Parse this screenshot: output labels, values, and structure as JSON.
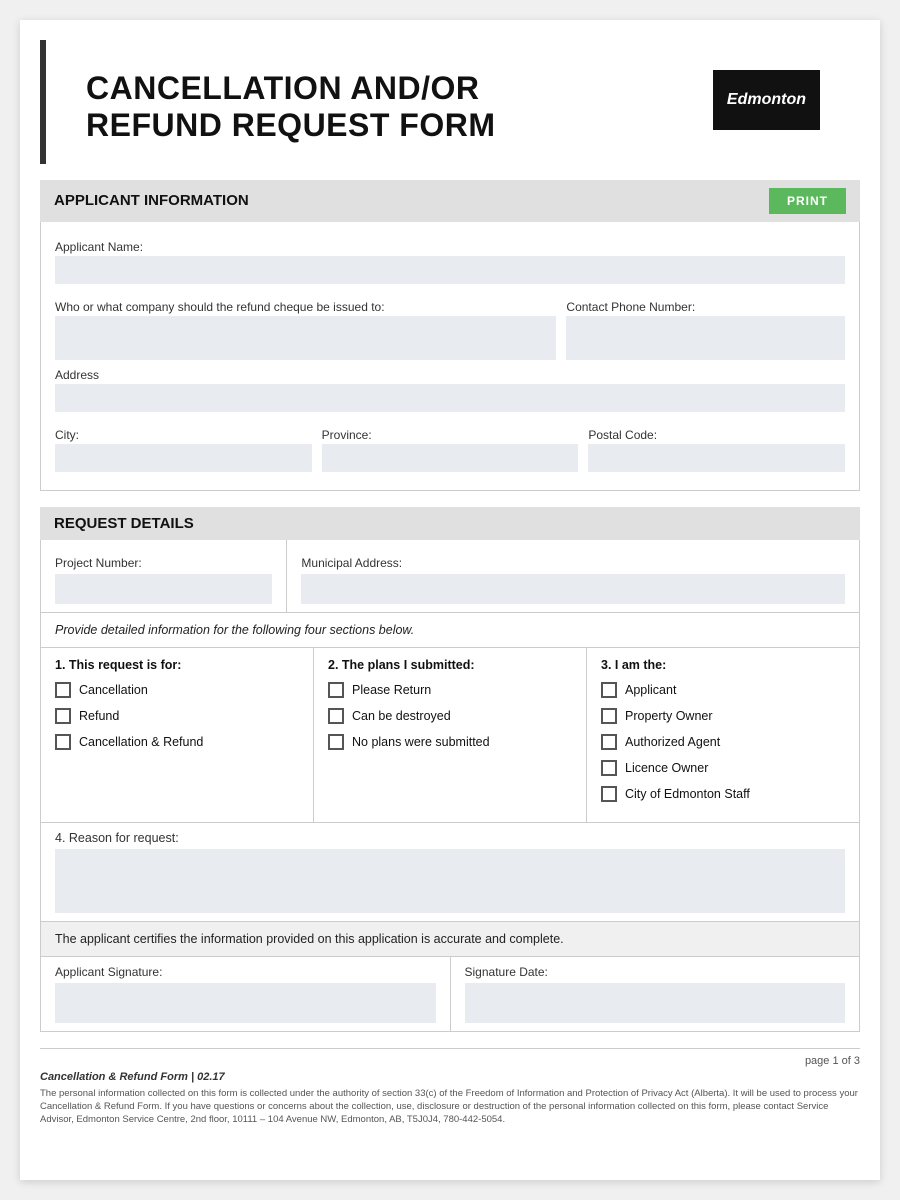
{
  "header": {
    "title_line1": "CANCELLATION AND/OR",
    "title_line2": "REFUND REQUEST FORM",
    "logo_text": "Edmonton"
  },
  "applicant_section": {
    "title": "APPLICANT INFORMATION",
    "print_button": "PRINT",
    "fields": {
      "applicant_name_label": "Applicant Name:",
      "refund_cheque_label": "Who or what company should the refund cheque be issued to:",
      "contact_phone_label": "Contact Phone Number:",
      "address_label": "Address",
      "city_label": "City:",
      "province_label": "Province:",
      "postal_code_label": "Postal Code:"
    }
  },
  "request_details_section": {
    "title": "REQUEST DETAILS",
    "project_number_label": "Project Number:",
    "municipal_address_label": "Municipal Address:",
    "instructions": "Provide detailed information for the following four sections below.",
    "section1_title": "1. This request is for:",
    "section1_items": [
      "Cancellation",
      "Refund",
      "Cancellation & Refund"
    ],
    "section2_title": "2. The plans I submitted:",
    "section2_items": [
      "Please Return",
      "Can be destroyed",
      "No plans were submitted"
    ],
    "section3_title": "3. I am the:",
    "section3_items": [
      "Applicant",
      "Property Owner",
      "Authorized Agent",
      "Licence Owner",
      "City of Edmonton Staff"
    ],
    "reason_label": "4. Reason for request:"
  },
  "certification": {
    "text": "The applicant certifies the information provided on this application is accurate and complete.",
    "signature_label": "Applicant Signature:",
    "date_label": "Signature Date:"
  },
  "footer": {
    "page_info": "page 1 of 3",
    "brand": "Cancellation & Refund Form  |  02.17",
    "legal": "The personal information collected on this form is collected under the authority of section 33(c) of the Freedom of Information and Protection of Privacy Act (Alberta). It will be used to process your Cancellation & Refund Form. If you have questions or concerns about the collection, use, disclosure or destruction of the personal information collected on this form, please contact Service Advisor, Edmonton Service Centre, 2nd floor, 10111 – 104 Avenue NW, Edmonton, AB, T5J0J4, 780-442-5054."
  }
}
